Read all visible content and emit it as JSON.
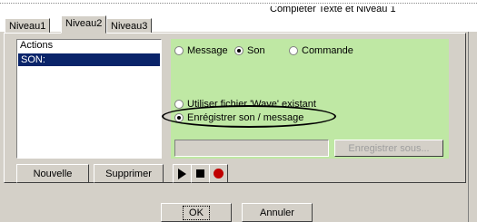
{
  "top_text": "Compléter Texte et Niveau 1",
  "tabs": [
    {
      "label": "Niveau1",
      "active": false
    },
    {
      "label": "Niveau2",
      "active": true
    },
    {
      "label": "Niveau3",
      "active": false
    }
  ],
  "actions": {
    "header": "Actions",
    "items": [
      {
        "label": "SON:",
        "selected": true
      }
    ]
  },
  "type_options": [
    {
      "label": "Message",
      "checked": false
    },
    {
      "label": "Son",
      "checked": true
    },
    {
      "label": "Commande",
      "checked": false
    }
  ],
  "source_options": [
    {
      "label": "Utiliser fichier 'Wave' existant",
      "checked": false
    },
    {
      "label": "Enrégistrer son / message",
      "checked": true
    }
  ],
  "filename_value": "",
  "save_as_label": "Enregistrer sous...",
  "nouvelle_label": "Nouvelle",
  "supprimer_label": "Supprimer",
  "transport": [
    "play-icon",
    "stop-icon",
    "record-icon"
  ],
  "ok_label": "OK",
  "annuler_label": "Annuler",
  "colors": {
    "panel": "#bfe8a4",
    "dialog": "#d4d0c8",
    "selection": "#0a246a",
    "record": "#c00000"
  }
}
